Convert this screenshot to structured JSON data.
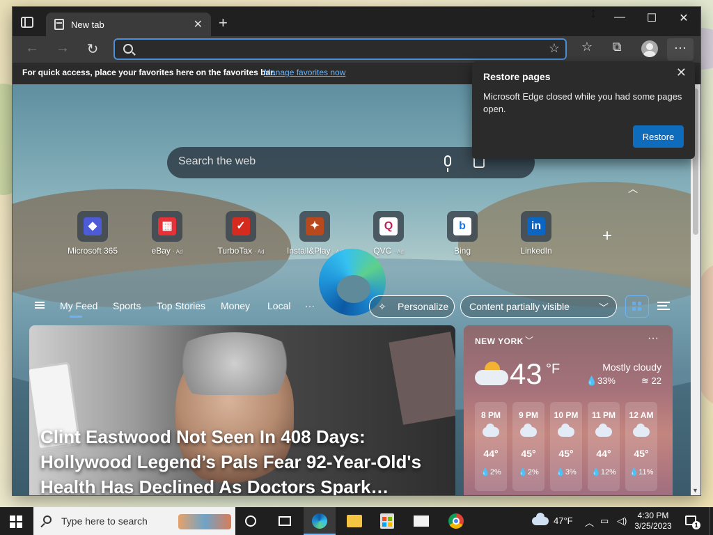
{
  "browser": {
    "tab_title": "New tab",
    "tab_close": "✕",
    "new_tab": "+",
    "window_controls": {
      "minimize": "—",
      "maximize": "☐",
      "close": "✕"
    },
    "address": {
      "value": "",
      "placeholder": ""
    },
    "favorites_bar": {
      "message": "For quick access, place your favorites here on the favorites bar.",
      "link": "Manage favorites now"
    }
  },
  "restore_popup": {
    "title": "Restore pages",
    "message": "Microsoft Edge closed while you had some pages open.",
    "button": "Restore",
    "close": "✕"
  },
  "ntp": {
    "search_placeholder": "Search the web",
    "quick_links": [
      {
        "label": "Microsoft 365",
        "ad": "",
        "color": "#4d5bd6",
        "glyph": "◆"
      },
      {
        "label": "eBay",
        "ad": "· Ad",
        "color": "#e53238",
        "glyph": "▦"
      },
      {
        "label": "TurboTax",
        "ad": "· Ad",
        "color": "#d52b1e",
        "glyph": "✓"
      },
      {
        "label": "Install&Play",
        "ad": "· Ad",
        "color": "#b8491c",
        "glyph": "✦"
      },
      {
        "label": "QVC",
        "ad": "· Ad",
        "color": "#ffffff",
        "glyph": "Q"
      },
      {
        "label": "Bing",
        "ad": "",
        "color": "#ffffff",
        "glyph": "b"
      },
      {
        "label": "LinkedIn",
        "ad": "",
        "color": "#0a66c2",
        "glyph": "in"
      }
    ],
    "feed_tabs": [
      "My Feed",
      "Sports",
      "Top Stories",
      "Money",
      "Local",
      "···"
    ],
    "personalize": "Personalize",
    "content_visibility": "Content partially visible",
    "hero_headline": "Clint Eastwood Not Seen In 408 Days: Hollywood Legend’s Pals Fear 92-Year-Old's Health Has Declined As Doctors Spark…"
  },
  "weather": {
    "city": "NEW YORK",
    "temp": "43",
    "unit": "°F",
    "condition": "Mostly cloudy",
    "precip": "💧33%",
    "wind": "≋ 22",
    "hourly": [
      {
        "time": "8 PM",
        "temp": "44°",
        "precip": "💧2%"
      },
      {
        "time": "9 PM",
        "temp": "45°",
        "precip": "💧2%"
      },
      {
        "time": "10 PM",
        "temp": "45°",
        "precip": "💧3%"
      },
      {
        "time": "11 PM",
        "temp": "44°",
        "precip": "💧12%"
      },
      {
        "time": "12 AM",
        "temp": "45°",
        "precip": "💧11%"
      }
    ]
  },
  "taskbar": {
    "search_placeholder": "Type here to search",
    "weather_temp": "47°F",
    "time": "4:30 PM",
    "date": "3/25/2023",
    "notifications": "1"
  }
}
